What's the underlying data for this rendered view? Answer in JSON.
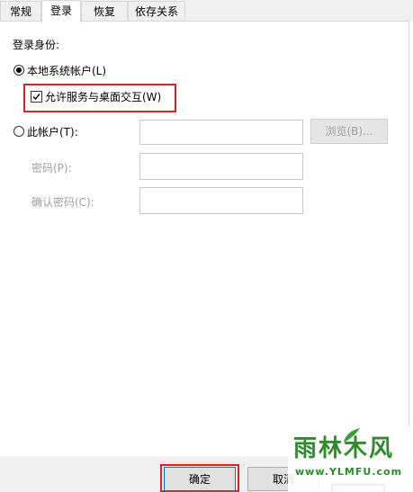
{
  "tabs": [
    {
      "label": "常规",
      "active": false
    },
    {
      "label": "登录",
      "active": true
    },
    {
      "label": "恢复",
      "active": false
    },
    {
      "label": "依存关系",
      "active": false
    }
  ],
  "logon": {
    "group_label": "登录身份:",
    "local_system": {
      "label": "本地系统帐户(L)",
      "selected": true
    },
    "interact_desktop": {
      "label": "允许服务与桌面交互(W)",
      "checked": true
    },
    "this_account": {
      "label": "此帐户(T):",
      "selected": false,
      "value": ""
    },
    "browse_button": "浏览(B)...",
    "password": {
      "label": "密码(P):",
      "value": ""
    },
    "confirm_password": {
      "label": "确认密码(C):",
      "value": ""
    }
  },
  "footer": {
    "ok_label": "确定",
    "cancel_label": "取消"
  },
  "watermark": {
    "text": "雨林木风",
    "url": "www.YLMFU.com"
  },
  "colors": {
    "highlight": "#d8252b",
    "tab_bg": "#f0f0f0",
    "watermark_green": "#2e8b2e"
  }
}
